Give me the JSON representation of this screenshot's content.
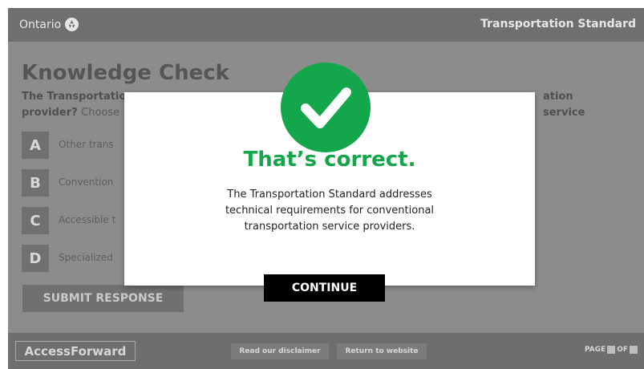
{
  "header": {
    "brand": "Ontario",
    "brand_icon": "trillium-icon",
    "course_title": "Transportation Standard"
  },
  "knowledge_check": {
    "title": "Knowledge Check",
    "question_visible_start": "The Transportatio",
    "question_visible_end": "ation service",
    "question_line2_bold": "provider?",
    "question_line2_instruction": "Choose",
    "options": [
      {
        "letter": "A",
        "text": "Other trans"
      },
      {
        "letter": "B",
        "text": "Convention"
      },
      {
        "letter": "C",
        "text": "Accessible t"
      },
      {
        "letter": "D",
        "text": "Specialized"
      }
    ],
    "submit_label": "SUBMIT RESPONSE"
  },
  "modal": {
    "icon": "checkmark-icon",
    "heading": "That’s correct.",
    "body_lines": [
      "The Transportation Standard addresses",
      "technical requirements for conventional",
      "transportation service providers."
    ],
    "continue_label": "CONTINUE",
    "accent_color": "#14a64a"
  },
  "footer": {
    "logo": "AccessForward",
    "disclaimer_label": "Read our disclaimer",
    "return_label": "Return to website",
    "page_label": "PAGE",
    "of_label": "OF"
  }
}
